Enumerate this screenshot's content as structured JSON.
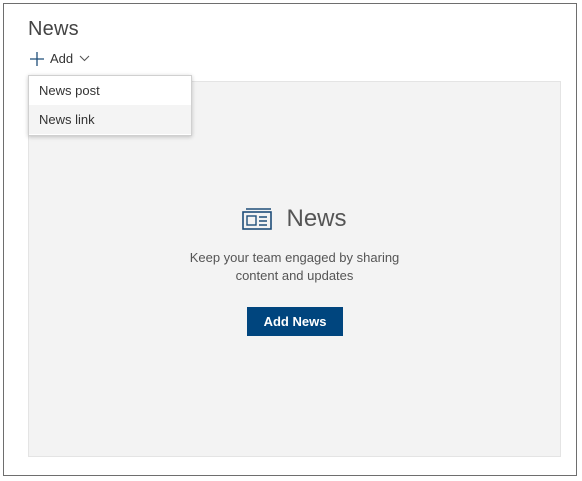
{
  "section": {
    "title": "News"
  },
  "command_bar": {
    "add_label": "Add",
    "add_icon": "plus-icon",
    "chevron_icon": "chevron-down-icon"
  },
  "dropdown": {
    "items": [
      {
        "label": "News post"
      },
      {
        "label": "News link"
      }
    ],
    "highlighted_index": 1
  },
  "placeholder": {
    "icon": "newspaper-icon",
    "title": "News",
    "description_line1": "Keep your team engaged by sharing",
    "description_line2": "content and updates",
    "button_label": "Add News"
  },
  "colors": {
    "accent": "#00457e",
    "icon": "#1f4e79",
    "placeholder_bg": "#f3f3f3"
  }
}
